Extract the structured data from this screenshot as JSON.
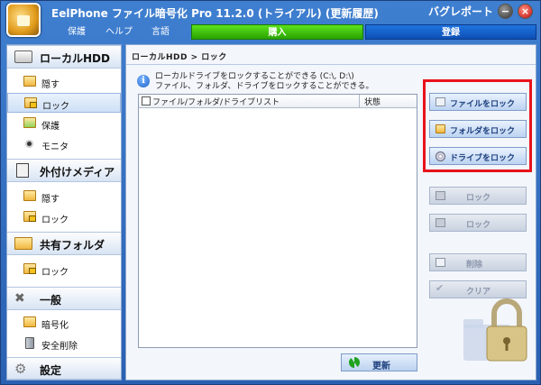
{
  "titlebar": {
    "title": "EelPhone ファイル暗号化 Pro 11.2.0 (トライアル) (更新履歴)",
    "bug_report": "バグレポート",
    "min_glyph": "−",
    "close_glyph": "×"
  },
  "menu": {
    "items": [
      "保護",
      "ヘルプ",
      "言語"
    ],
    "buy": "購入",
    "register": "登録"
  },
  "sidebar": {
    "sections": [
      {
        "label": "ローカルHDD",
        "icon": "hard-drive-icon"
      },
      {
        "label": "外付けメディア",
        "icon": "usb-icon"
      },
      {
        "label": "共有フォルダ",
        "icon": "shared-folder-icon"
      },
      {
        "label": "一般",
        "icon": "tools-icon"
      },
      {
        "label": "設定",
        "icon": "gear-icon"
      }
    ],
    "items": {
      "local_hide": "隠す",
      "local_lock": "ロック",
      "local_protect": "保護",
      "local_monitor": "モニタ",
      "ext_hide": "隠す",
      "ext_lock": "ロック",
      "shared_lock": "ロック",
      "general_encrypt": "暗号化",
      "general_shred": "安全削除"
    }
  },
  "main": {
    "breadcrumb": "ローカルHDD > ロック",
    "info_line1": "ローカルドライブをロックすることができる (C:\\, D:\\)",
    "info_line2": "ファイル、フォルダ、ドライブをロックすることができる。",
    "columns": [
      "ファイル/フォルダ/ドライブリスト",
      "状態"
    ],
    "refresh": "更新"
  },
  "actions": {
    "lock_file": "ファイルをロック",
    "lock_folder": "フォルダをロック",
    "lock_drive": "ドライブをロック",
    "lock": "ロック",
    "unlock": "ロック",
    "delete": "削除",
    "clear": "クリア"
  },
  "colors": {
    "buy": "#3cc40e",
    "register": "#1f63c8",
    "highlight": "#e8131b"
  }
}
